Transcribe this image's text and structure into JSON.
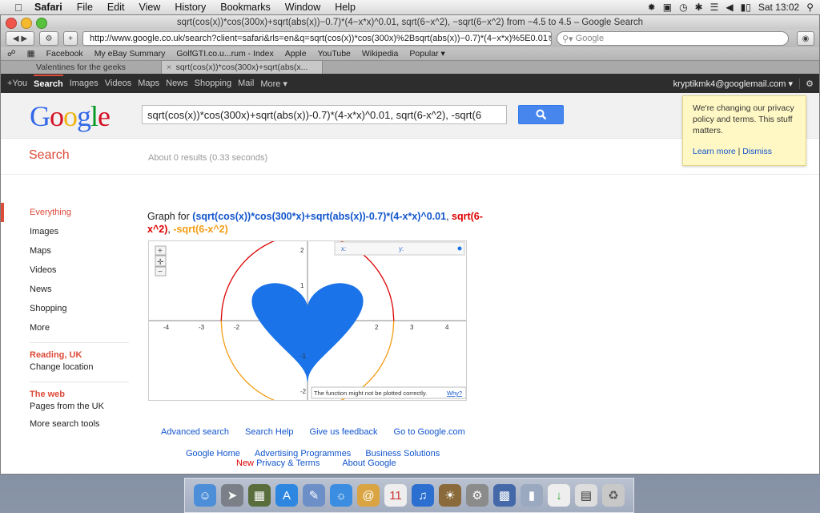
{
  "menubar": {
    "app": "Safari",
    "items": [
      "File",
      "Edit",
      "View",
      "History",
      "Bookmarks",
      "Window",
      "Help"
    ],
    "clock": "Sat 13:02"
  },
  "window": {
    "title": "sqrt(cos(x))*cos(300x)+sqrt(abs(x))−0.7)*(4−x*x)^0.01, sqrt(6−x^2), −sqrt(6−x^2) from −4.5 to 4.5 – Google Search",
    "url": "http://www.google.co.uk/search?client=safari&rls=en&q=sqrt(cos(x))*cos(300x)%2Bsqrt(abs(x))−0.7)*(4−x*x)%5E0.01",
    "search_placeholder": "Google"
  },
  "bookmarks": [
    "Facebook",
    "My eBay Summary",
    "GolfGTI.co.u...rum - Index",
    "Apple",
    "YouTube",
    "Wikipedia",
    "Popular ▾"
  ],
  "tabs": [
    {
      "label": "Valentines for the geeks"
    },
    {
      "label": "sqrt(cos(x))*cos(300x)+sqrt(abs(x..."
    }
  ],
  "gbar": {
    "items": [
      "+You",
      "Search",
      "Images",
      "Videos",
      "Maps",
      "News",
      "Shopping",
      "Mail",
      "More ▾"
    ],
    "account": "kryptikmk4@googlemail.com ▾"
  },
  "header": {
    "logo": "Google",
    "query": "sqrt(cos(x))*cos(300x)+sqrt(abs(x))-0.7)*(4-x*x)^0.01, sqrt(6-x^2), -sqrt(6"
  },
  "tooltip": {
    "text": "We're changing our privacy policy and terms. This stuff matters.",
    "learn": "Learn more",
    "sep": " | ",
    "dismiss": "Dismiss"
  },
  "searchrow": {
    "label": "Search",
    "stats": "About 0 results (0.33 seconds)"
  },
  "leftnav": {
    "items": [
      "Everything",
      "Images",
      "Maps",
      "Videos",
      "News",
      "Shopping",
      "More"
    ],
    "location_head": "Reading, UK",
    "location_change": "Change location",
    "web_head": "The web",
    "web_sub": "Pages from the UK",
    "tools": "More search tools"
  },
  "graph": {
    "title_prefix": "Graph for ",
    "f1": "(sqrt(cos(x))*cos(300*x)+sqrt(abs(x))-0.7)*(4-x*x)^0.01",
    "f2": "sqrt(6-x^2)",
    "f3": "-sqrt(6-x^2)",
    "x_label": "x:",
    "y_label": "y:",
    "warning": "The function might not be plotted correctly.",
    "why": "Why?",
    "xticks": [
      "-4",
      "-3",
      "-2",
      "2",
      "3",
      "4"
    ],
    "yticks": [
      "2",
      "1",
      "-1",
      "-2"
    ]
  },
  "footer": {
    "row1": [
      "Advanced search",
      "Search Help",
      "Give us feedback",
      "Go to Google.com"
    ],
    "row2": [
      "Google Home",
      "Advertising Programmes",
      "Business Solutions"
    ],
    "new": "New",
    "privacy": "Privacy & Terms",
    "about": "About Google"
  },
  "colors": {
    "f1": "#1a73e8",
    "f2": "#dd0000",
    "f3": "#f39c12",
    "accent": "#dd4b39"
  }
}
